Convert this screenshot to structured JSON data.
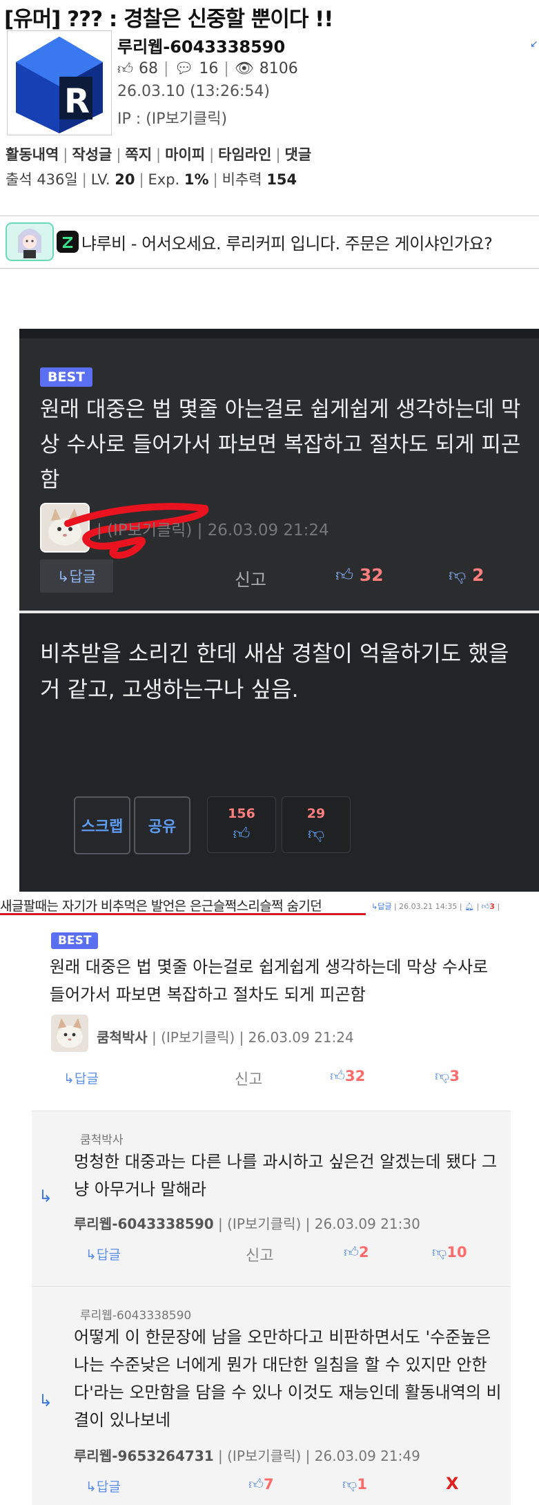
{
  "post": {
    "title": "[유머] ??? : 경찰은 신중할 뿐이다 !!",
    "author": "루리웹-6043338590",
    "likes": "68",
    "comments": "16",
    "views": "8106",
    "date": "26.03.10 (13:26:54)",
    "ip": "IP : (IP보기클릭)"
  },
  "profile_menu": [
    "활동내역",
    "작성글",
    "쪽지",
    "마이피",
    "타임라인",
    "댓글"
  ],
  "profile_info": {
    "attendance": "출석 436일",
    "lv_label": "LV.",
    "lv": "20",
    "exp_label": "Exp.",
    "exp": "1%",
    "dislike_label": "비추력",
    "dislike": "154"
  },
  "welcome": "냐루비 - 어서오세요. 루리커피 입니다. 주문은 게이샤인가요?",
  "dark_screenshot": {
    "badge": "BEST",
    "comment": "원래 대중은 법 몇줄 아는걸로 쉽게쉽게 생각하는데 막상 수사로 들어가서 파보면 복잡하고 절차도 되게 피곤함",
    "meta": "| (IP보기클릭) | 26.03.09 21:24",
    "reply_label": "↳답글",
    "report_label": "신고",
    "up_count": "32",
    "down_count": "2",
    "body": "비추받을 소리긴 한데 새삼 경찰이 억울하기도 했을 거 같고, 고생하는구나 싶음.",
    "scrap_label": "스크랩",
    "share_label": "공유",
    "upvotes": "156",
    "downvotes": "29"
  },
  "caption": {
    "text": "새글팔때는 자기가 비추먹은 발언은 은근슬쩍스리슬쩍 숨기던",
    "reply_label": "↳답글",
    "date": "26.03.21 14:35",
    "up_count": "3"
  },
  "best_comment": {
    "badge": "BEST",
    "text": "원래 대중은 법 몇줄 아는걸로 쉽게쉽게 생각하는데 막상 수사로 들어가서 파보면 복잡하고 절차도 되게 피곤함",
    "author": "쿰척박사",
    "meta": "| (IP보기클릭) | 26.03.09 21:24",
    "reply_label": "↳답글",
    "report_label": "신고",
    "up_count": "32",
    "down_count": "3"
  },
  "replies": [
    {
      "reply_to": "쿰척박사",
      "text": "멍청한 대중과는 다른 나를 과시하고 싶은건 알겠는데 됐다 그냥 아무거나 말해라",
      "author": "루리웹-6043338590",
      "meta": "| (IP보기클릭) | 26.03.09 21:30",
      "reply_label": "↳답글",
      "report_label": "신고",
      "up_count": "2",
      "down_count": "10"
    },
    {
      "reply_to": "루리웹-6043338590",
      "text": "어떻게 이 한문장에 남을 오만하다고 비판하면서도 '수준높은 나는 수준낮은 너에게 뭔가 대단한 일침을 할 수 있지만 안한다'라는 오만함을 담을 수 있나 이것도 재능인데 활동내역의 비결이 있나보네",
      "author": "루리웹-9653264731",
      "meta": "| (IP보기클릭) | 26.03.09 21:49",
      "reply_label": "↳답글",
      "up_count": "7",
      "down_count": "1",
      "delete_label": "X"
    }
  ],
  "colors": {
    "best_badge": "#5b6ff2",
    "vote_red": "#ff6b6b",
    "link_blue": "#3b78e0",
    "caption_underline": "#d8162a",
    "dark_bg": "#2b2c2e"
  }
}
